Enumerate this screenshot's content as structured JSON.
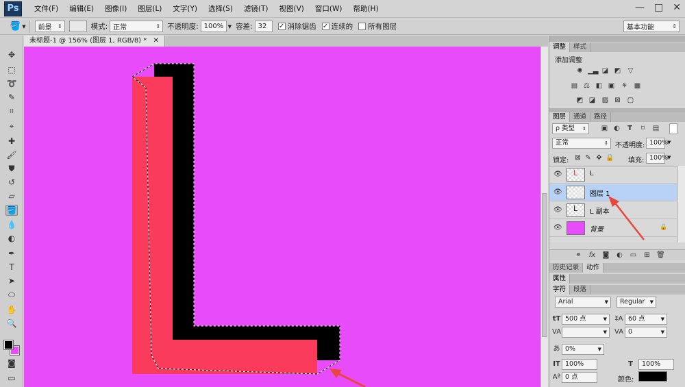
{
  "app": {
    "logo": "Ps",
    "window_controls": [
      "—",
      "□",
      "✕"
    ]
  },
  "menu": [
    "文件(F)",
    "编辑(E)",
    "图像(I)",
    "图层(L)",
    "文字(Y)",
    "选择(S)",
    "滤镜(T)",
    "视图(V)",
    "窗口(W)",
    "帮助(H)"
  ],
  "options": {
    "fill_source": "前景",
    "mode_label": "模式:",
    "mode_value": "正常",
    "opacity_label": "不透明度:",
    "opacity_value": "100%",
    "tolerance_label": "容差:",
    "tolerance_value": "32",
    "antialias_label": "消除锯齿",
    "contiguous_label": "连续的",
    "all_layers_label": "所有图层",
    "workspace": "基本功能"
  },
  "document": {
    "tab_title": "未标题-1 @ 156% (图层 1, RGB/8) *",
    "canvas_color": "#e84cfa"
  },
  "artwork": {
    "front_color": "#fb3b5c",
    "back_color": "#000000",
    "arrow_color": "#e8473c"
  },
  "adjust_panel": {
    "tabs": [
      "调整",
      "样式"
    ],
    "title": "添加调整"
  },
  "layers_panel": {
    "tabs": [
      "图层",
      "通道",
      "路径"
    ],
    "filter_label": "ρ 类型",
    "blend_mode": "正常",
    "opacity_label": "不透明度:",
    "opacity_value": "100%",
    "lock_label": "锁定:",
    "fill_label": "填充:",
    "fill_value": "100%",
    "layers": [
      {
        "name": "L",
        "selected": false
      },
      {
        "name": "图层 1",
        "selected": true
      },
      {
        "name": "L 副本",
        "selected": false
      },
      {
        "name": "背景",
        "selected": false
      }
    ]
  },
  "history_panel": {
    "tabs": [
      "历史记录",
      "动作"
    ]
  },
  "properties_panel": {
    "title": "属性"
  },
  "character_panel": {
    "tabs": [
      "字符",
      "段落"
    ],
    "font_family": "Arial",
    "font_style": "Regular",
    "font_size": "500 点",
    "leading": "60 点",
    "tracking": "0",
    "kerning_scale": "0%",
    "vertical_scale": "100%",
    "horizontal_scale": "100%",
    "baseline": "0 点",
    "color_label": "颜色:"
  }
}
